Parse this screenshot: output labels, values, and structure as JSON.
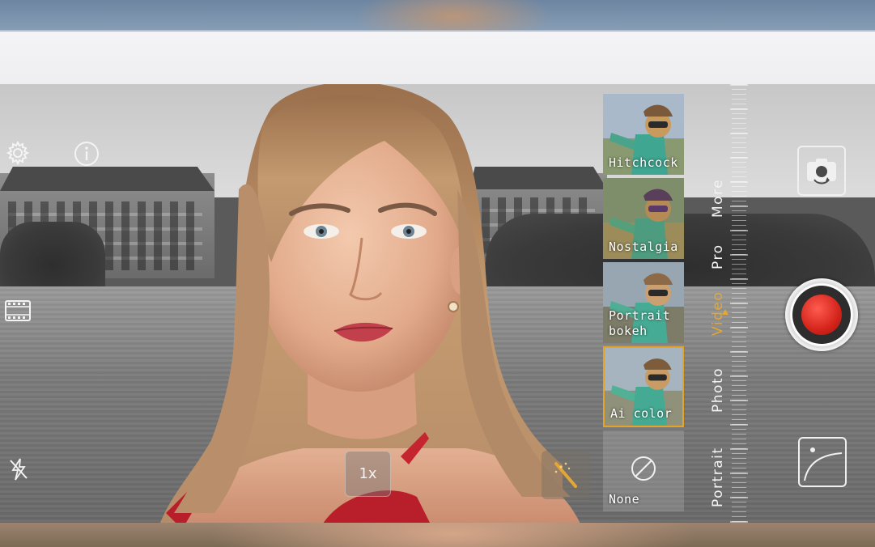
{
  "camera": {
    "zoom_label": "1x",
    "filters": [
      {
        "label": "Hitchcock",
        "selected": false
      },
      {
        "label": "Nostalgia",
        "selected": false
      },
      {
        "label": "Portrait bokeh",
        "selected": false
      },
      {
        "label": "Ai color",
        "selected": true
      },
      {
        "label": "None",
        "selected": false
      }
    ],
    "modes": [
      {
        "label": "More",
        "active": false
      },
      {
        "label": "Pro",
        "active": false
      },
      {
        "label": "Video",
        "active": true
      },
      {
        "label": "Photo",
        "active": false
      },
      {
        "label": "Portrait",
        "active": false
      }
    ],
    "icons": {
      "settings": "gear-icon",
      "info": "info-icon",
      "filmstrip": "filmstrip-icon",
      "flash_off": "flash-off-icon",
      "switch_camera": "switch-camera-icon",
      "record": "record-button",
      "gallery": "gallery-thumbnail",
      "magic_wand": "magic-wand-icon",
      "none_filter": "no-filter-icon"
    },
    "colors": {
      "accent": "#e5a733",
      "record": "#d4241b"
    }
  }
}
